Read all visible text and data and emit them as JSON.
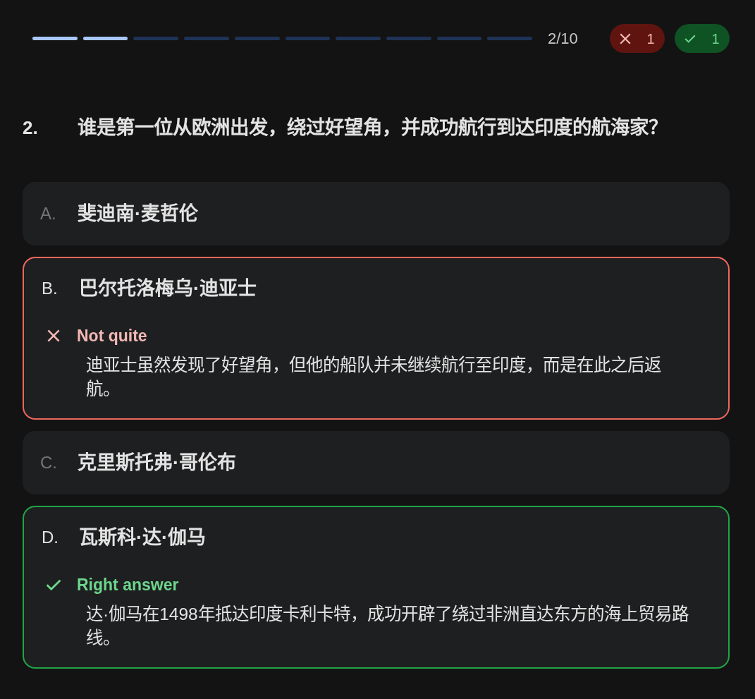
{
  "progress": {
    "segments": [
      {
        "filled": true
      },
      {
        "filled": true
      },
      {
        "filled": false
      },
      {
        "filled": false
      },
      {
        "filled": false
      },
      {
        "filled": false
      },
      {
        "filled": false
      },
      {
        "filled": false
      },
      {
        "filled": false
      },
      {
        "filled": false
      }
    ],
    "counter": "2/10"
  },
  "scores": [
    {
      "kind": "wrong",
      "count": "1"
    },
    {
      "kind": "correct",
      "count": "1"
    }
  ],
  "question": {
    "number": "2.",
    "text": "谁是第一位从欧洲出发，绕过好望角，并成功航行到达印度的航海家？"
  },
  "options": [
    {
      "letter": "A.",
      "text": "斐迪南·麦哲伦",
      "kind": "plain"
    },
    {
      "letter": "B.",
      "text": "巴尔托洛梅乌·迪亚士",
      "kind": "wrong",
      "feedback": {
        "title": "Not quite",
        "explanation": "迪亚士虽然发现了好望角，但他的船队并未继续航行至印度，而是在此之后返航。"
      }
    },
    {
      "letter": "C.",
      "text": "克里斯托弗·哥伦布",
      "kind": "plain"
    },
    {
      "letter": "D.",
      "text": "瓦斯科·达·伽马",
      "kind": "correct",
      "feedback": {
        "title": "Right answer",
        "explanation": "达·伽马在1498年抵达印度卡利卡特，成功开辟了绕过非洲直达东方的海上贸易路线。"
      }
    }
  ]
}
